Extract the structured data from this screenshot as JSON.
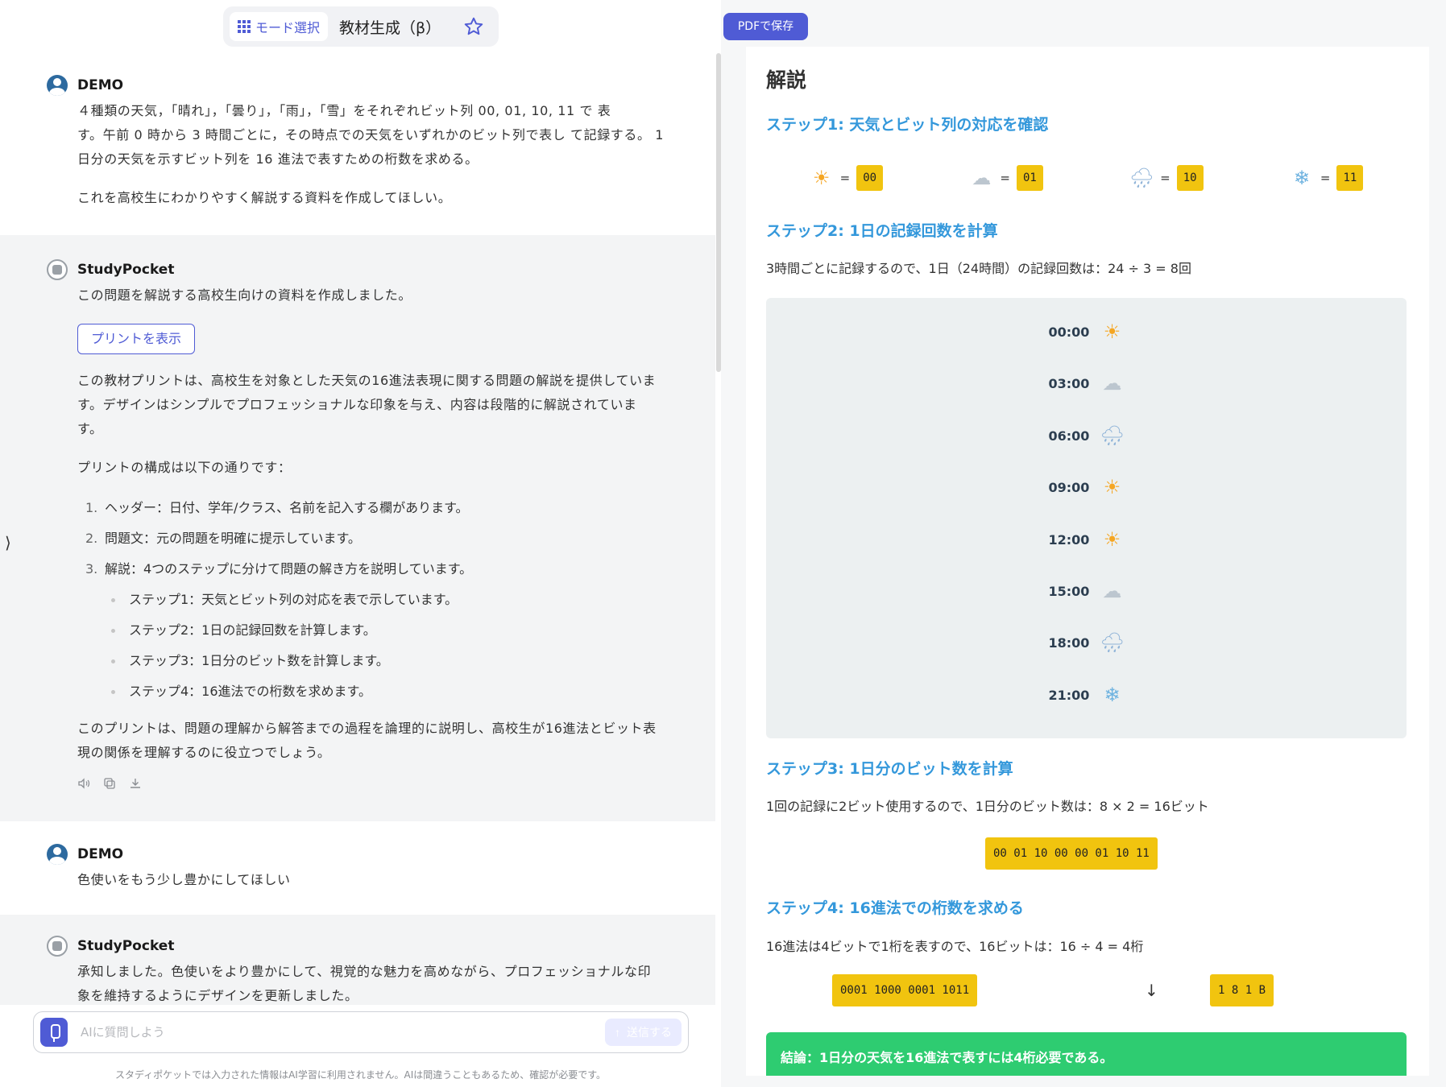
{
  "topbar": {
    "mode_label": "モード選択",
    "mode_title": "教材生成（β）"
  },
  "messages": {
    "m1": {
      "author": "DEMO",
      "text1": "４種類の天気，「晴れ」，「曇り」，「雨」，「雪」をそれぞれビット列 00, 01, 10, 11 で 表",
      "text2": "す。午前 0 時から 3 時間ごとに，その時点での天気をいずれかのビット列で表し て記録する。 1",
      "text3": "日分の天気を示すビット列を 16 進法で表すための桁数を求める。",
      "text4": "これを高校生にわかりやすく解説する資料を作成してほしい。"
    },
    "m2": {
      "author": "StudyPocket",
      "intro": "この問題を解説する高校生向けの資料を作成しました。",
      "print_button": "プリントを表示",
      "desc1": "この教材プリントは、高校生を対象とした天気の16進法表現に関する問題の解説を提供していま",
      "desc2": "す。デザインはシンプルでプロフェッショナルな印象を与え、内容は段階的に解説されていま",
      "desc3": "す。",
      "structure": "プリントの構成は以下の通りです：",
      "items": [
        {
          "num": "1.",
          "text": "ヘッダー：日付、学年/クラス、名前を記入する欄があります。"
        },
        {
          "num": "2.",
          "text": "問題文：元の問題を明確に提示しています。"
        },
        {
          "num": "3.",
          "text": "解説：4つのステップに分けて問題の解き方を説明しています。"
        }
      ],
      "sub_items": [
        "ステップ1：天気とビット列の対応を表で示しています。",
        "ステップ2：1日の記録回数を計算します。",
        "ステップ3：1日分のビット数を計算します。",
        "ステップ4：16進法での桁数を求めます。"
      ],
      "summary1": "このプリントは、問題の理解から解答までの過程を論理的に説明し、高校生が16進法とビット表",
      "summary2": "現の関係を理解するのに役立つでしょう。"
    },
    "m3": {
      "author": "DEMO",
      "text": "色使いをもう少し豊かにしてほしい"
    },
    "m4": {
      "author": "StudyPocket",
      "text1": "承知しました。色使いをより豊かにして、視覚的な魅力を高めながら、プロフェッショナルな印",
      "text2": "象を維持するようにデザインを更新しました。"
    }
  },
  "collapse_arrow": "⟩",
  "composer": {
    "placeholder": "AIに質問しよう",
    "send_label": "送信する",
    "disclaimer": "スタディポケットでは入力された情報はAI学習に利用されません。AIは間違うこともあるため、確認が必要です。"
  },
  "right_panel": {
    "pdf_button": "PDFで保存",
    "title": "解説",
    "step1_title": "ステップ1: 天気とビット列の対応を確認",
    "mapping": [
      {
        "icon": "sun-icon",
        "glyph": "☀",
        "eq": "=",
        "bits": "00"
      },
      {
        "icon": "cloud-icon",
        "glyph": "☁",
        "eq": "=",
        "bits": "01"
      },
      {
        "icon": "rain-icon",
        "glyph": "🌧",
        "eq": "=",
        "bits": "10"
      },
      {
        "icon": "snow-icon",
        "glyph": "❄",
        "eq": "=",
        "bits": "11"
      }
    ],
    "step2_title": "ステップ2: 1日の記録回数を計算",
    "step2_text": "3時間ごとに記録するので、1日（24時間）の記録回数は：24 ÷ 3 = 8回",
    "timeline": [
      {
        "time": "00:00",
        "icon": "sun-icon",
        "glyph": "☀"
      },
      {
        "time": "03:00",
        "icon": "cloud-icon",
        "glyph": "☁"
      },
      {
        "time": "06:00",
        "icon": "rain-icon",
        "glyph": "🌧"
      },
      {
        "time": "09:00",
        "icon": "sun-icon",
        "glyph": "☀"
      },
      {
        "time": "12:00",
        "icon": "sun-icon",
        "glyph": "☀"
      },
      {
        "time": "15:00",
        "icon": "cloud-icon",
        "glyph": "☁"
      },
      {
        "time": "18:00",
        "icon": "rain-icon",
        "glyph": "🌧"
      },
      {
        "time": "21:00",
        "icon": "snow-icon",
        "glyph": "❄"
      }
    ],
    "step3_title": "ステップ3: 1日分のビット数を計算",
    "step3_text": "1回の記録に2ビット使用するので、1日分のビット数は：8 × 2 = 16ビット",
    "bitstring": "00 01 10 00 00 01 10 11",
    "step4_title": "ステップ4: 16進法での桁数を求める",
    "step4_text": "16進法は4ビットで1桁を表すので、16ビットは：16 ÷ 4 = 4桁",
    "hex_left": "0001 1000 0001 1011",
    "hex_arrow": "↓",
    "hex_right": "1 8 1 B",
    "conclusion": "結論：1日分の天気を16進法で表すには4桁必要である。"
  },
  "colors": {
    "accent": "#4f5bd5",
    "step_heading": "#3498db",
    "bit_highlight": "#f1c40f",
    "conclusion_bg": "#2ecc71"
  }
}
